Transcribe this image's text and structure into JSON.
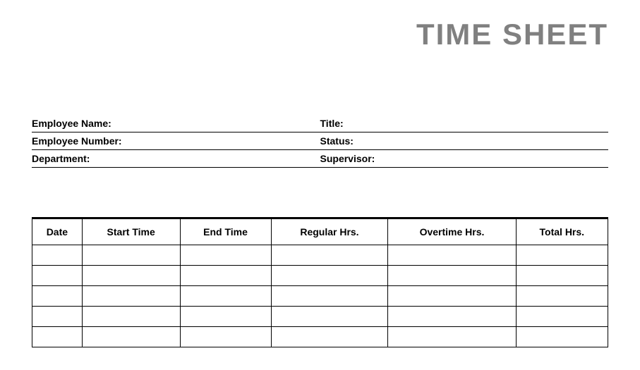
{
  "title": "TIME SHEET",
  "info": {
    "row1": {
      "left": "Employee Name:",
      "right": "Title:"
    },
    "row2": {
      "left": "Employee Number:",
      "right": "Status:"
    },
    "row3": {
      "left": "Department:",
      "right": "Supervisor:"
    }
  },
  "table": {
    "headers": [
      "Date",
      "Start Time",
      "End Time",
      "Regular Hrs.",
      "Overtime Hrs.",
      "Total Hrs."
    ],
    "rows": [
      [
        "",
        "",
        "",
        "",
        "",
        ""
      ],
      [
        "",
        "",
        "",
        "",
        "",
        ""
      ],
      [
        "",
        "",
        "",
        "",
        "",
        ""
      ],
      [
        "",
        "",
        "",
        "",
        "",
        ""
      ],
      [
        "",
        "",
        "",
        "",
        "",
        ""
      ]
    ]
  }
}
